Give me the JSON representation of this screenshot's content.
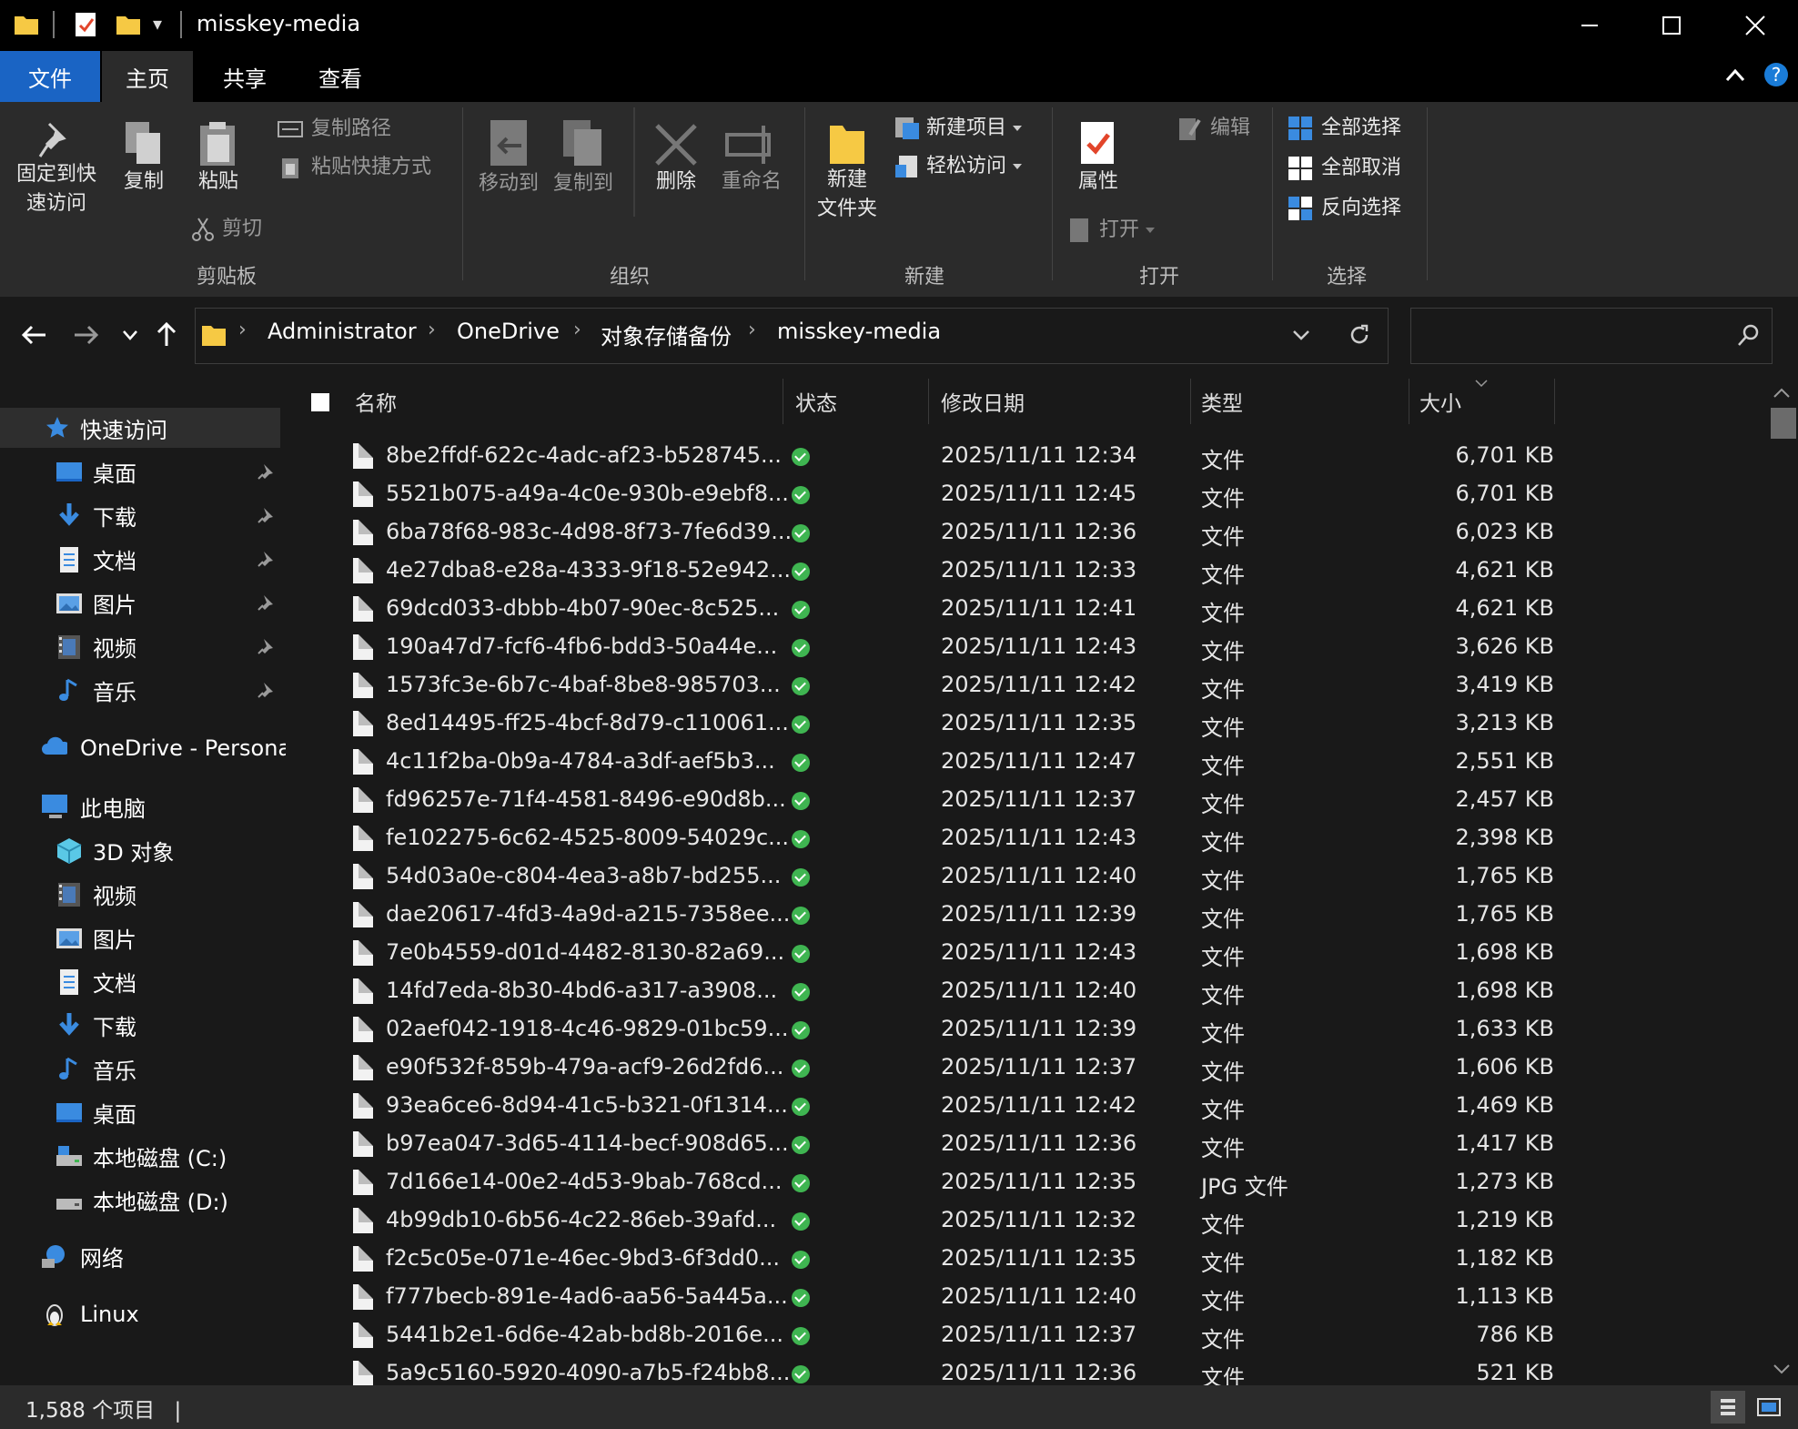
{
  "window": {
    "title": "misskey-media",
    "quick_access_arrow": "▾"
  },
  "tabs": [
    {
      "label": "文件",
      "active": false
    },
    {
      "label": "主页",
      "active": true
    },
    {
      "label": "共享",
      "active": false
    },
    {
      "label": "查看",
      "active": false
    }
  ],
  "ribbon": {
    "clipboard": {
      "group_label": "剪贴板",
      "pin_label_line1": "固定到快",
      "pin_label_line2": "速访问",
      "copy_label": "复制",
      "paste_label": "粘贴",
      "copy_path_label": "复制路径",
      "paste_shortcut_label": "粘贴快捷方式",
      "cut_label": "剪切"
    },
    "organize": {
      "group_label": "组织",
      "move_to_label": "移动到",
      "copy_to_label": "复制到",
      "delete_label": "删除",
      "rename_label": "重命名"
    },
    "new": {
      "group_label": "新建",
      "new_folder_line1": "新建",
      "new_folder_line2": "文件夹",
      "new_item_label": "新建项目",
      "easy_access_label": "轻松访问"
    },
    "open": {
      "group_label": "打开",
      "properties_label": "属性",
      "open_label": "打开",
      "edit_label": "编辑"
    },
    "select": {
      "group_label": "选择",
      "select_all_label": "全部选择",
      "select_none_label": "全部取消",
      "invert_label": "反向选择"
    }
  },
  "address": {
    "crumbs": [
      "Administrator",
      "OneDrive",
      "对象存储备份",
      "misskey-media"
    ],
    "search_placeholder": ""
  },
  "sidebar": {
    "quick_access": "快速访问",
    "quick_items": [
      {
        "label": "桌面",
        "icon": "desktop-icon"
      },
      {
        "label": "下载",
        "icon": "download-icon"
      },
      {
        "label": "文档",
        "icon": "document-icon"
      },
      {
        "label": "图片",
        "icon": "picture-icon"
      },
      {
        "label": "视频",
        "icon": "video-icon"
      },
      {
        "label": "音乐",
        "icon": "music-icon"
      }
    ],
    "onedrive": "OneDrive - Persona",
    "this_pc": "此电脑",
    "pc_items": [
      {
        "label": "3D 对象",
        "icon": "3d-objects-icon"
      },
      {
        "label": "视频",
        "icon": "video-icon"
      },
      {
        "label": "图片",
        "icon": "picture-icon"
      },
      {
        "label": "文档",
        "icon": "document-icon"
      },
      {
        "label": "下载",
        "icon": "download-icon"
      },
      {
        "label": "音乐",
        "icon": "music-icon"
      },
      {
        "label": "桌面",
        "icon": "desktop-icon"
      },
      {
        "label": "本地磁盘 (C:)",
        "icon": "drive-c-icon"
      },
      {
        "label": "本地磁盘 (D:)",
        "icon": "drive-d-icon"
      }
    ],
    "network": "网络",
    "linux": "Linux"
  },
  "columns": {
    "name": "名称",
    "status": "状态",
    "modified": "修改日期",
    "type": "类型",
    "size": "大小"
  },
  "files": [
    {
      "name": "8be2ffdf-622c-4adc-af23-b528745...",
      "date": "2025/11/11 12:34",
      "type": "文件",
      "size": "6,701 KB"
    },
    {
      "name": "5521b075-a49a-4c0e-930b-e9ebf8...",
      "date": "2025/11/11 12:45",
      "type": "文件",
      "size": "6,701 KB"
    },
    {
      "name": "6ba78f68-983c-4d98-8f73-7fe6d39...",
      "date": "2025/11/11 12:36",
      "type": "文件",
      "size": "6,023 KB"
    },
    {
      "name": "4e27dba8-e28a-4333-9f18-52e942...",
      "date": "2025/11/11 12:33",
      "type": "文件",
      "size": "4,621 KB"
    },
    {
      "name": "69dcd033-dbbb-4b07-90ec-8c525...",
      "date": "2025/11/11 12:41",
      "type": "文件",
      "size": "4,621 KB"
    },
    {
      "name": "190a47d7-fcf6-4fb6-bdd3-50a44e...",
      "date": "2025/11/11 12:43",
      "type": "文件",
      "size": "3,626 KB"
    },
    {
      "name": "1573fc3e-6b7c-4baf-8be8-985703...",
      "date": "2025/11/11 12:42",
      "type": "文件",
      "size": "3,419 KB"
    },
    {
      "name": "8ed14495-ff25-4bcf-8d79-c110061...",
      "date": "2025/11/11 12:35",
      "type": "文件",
      "size": "3,213 KB"
    },
    {
      "name": "4c11f2ba-0b9a-4784-a3df-aef5b3...",
      "date": "2025/11/11 12:47",
      "type": "文件",
      "size": "2,551 KB"
    },
    {
      "name": "fd96257e-71f4-4581-8496-e90d8b...",
      "date": "2025/11/11 12:37",
      "type": "文件",
      "size": "2,457 KB"
    },
    {
      "name": "fe102275-6c62-4525-8009-54029c...",
      "date": "2025/11/11 12:43",
      "type": "文件",
      "size": "2,398 KB"
    },
    {
      "name": "54d03a0e-c804-4ea3-a8b7-bd255...",
      "date": "2025/11/11 12:40",
      "type": "文件",
      "size": "1,765 KB"
    },
    {
      "name": "dae20617-4fd3-4a9d-a215-7358ee...",
      "date": "2025/11/11 12:39",
      "type": "文件",
      "size": "1,765 KB"
    },
    {
      "name": "7e0b4559-d01d-4482-8130-82a69...",
      "date": "2025/11/11 12:43",
      "type": "文件",
      "size": "1,698 KB"
    },
    {
      "name": "14fd7eda-8b30-4bd6-a317-a3908...",
      "date": "2025/11/11 12:40",
      "type": "文件",
      "size": "1,698 KB"
    },
    {
      "name": "02aef042-1918-4c46-9829-01bc59...",
      "date": "2025/11/11 12:39",
      "type": "文件",
      "size": "1,633 KB"
    },
    {
      "name": "e90f532f-859b-479a-acf9-26d2fd6...",
      "date": "2025/11/11 12:37",
      "type": "文件",
      "size": "1,606 KB"
    },
    {
      "name": "93ea6ce6-8d94-41c5-b321-0f1314...",
      "date": "2025/11/11 12:42",
      "type": "文件",
      "size": "1,469 KB"
    },
    {
      "name": "b97ea047-3d65-4114-becf-908d65...",
      "date": "2025/11/11 12:36",
      "type": "文件",
      "size": "1,417 KB"
    },
    {
      "name": "7d166e14-00e2-4d53-9bab-768cd...",
      "date": "2025/11/11 12:35",
      "type": "JPG 文件",
      "size": "1,273 KB"
    },
    {
      "name": "4b99db10-6b56-4c22-86eb-39afd...",
      "date": "2025/11/11 12:32",
      "type": "文件",
      "size": "1,219 KB"
    },
    {
      "name": "f2c5c05e-071e-46ec-9bd3-6f3dd0...",
      "date": "2025/11/11 12:35",
      "type": "文件",
      "size": "1,182 KB"
    },
    {
      "name": "f777becb-891e-4ad6-aa56-5a445a...",
      "date": "2025/11/11 12:40",
      "type": "文件",
      "size": "1,113 KB"
    },
    {
      "name": "5441b2e1-6d6e-42ab-bd8b-2016e...",
      "date": "2025/11/11 12:37",
      "type": "文件",
      "size": "786 KB"
    },
    {
      "name": "5a9c5160-5920-4090-a7b5-f24bb8...",
      "date": "2025/11/11 12:36",
      "type": "文件",
      "size": "521 KB"
    }
  ],
  "status_bar": {
    "item_count": "1,588 个项目",
    "separator": "|"
  },
  "colors": {
    "accent": "#1a64c4",
    "folder": "#f6c944",
    "synced": "#3fb551",
    "background": "#191919",
    "ribbon": "#2b2b2b"
  }
}
